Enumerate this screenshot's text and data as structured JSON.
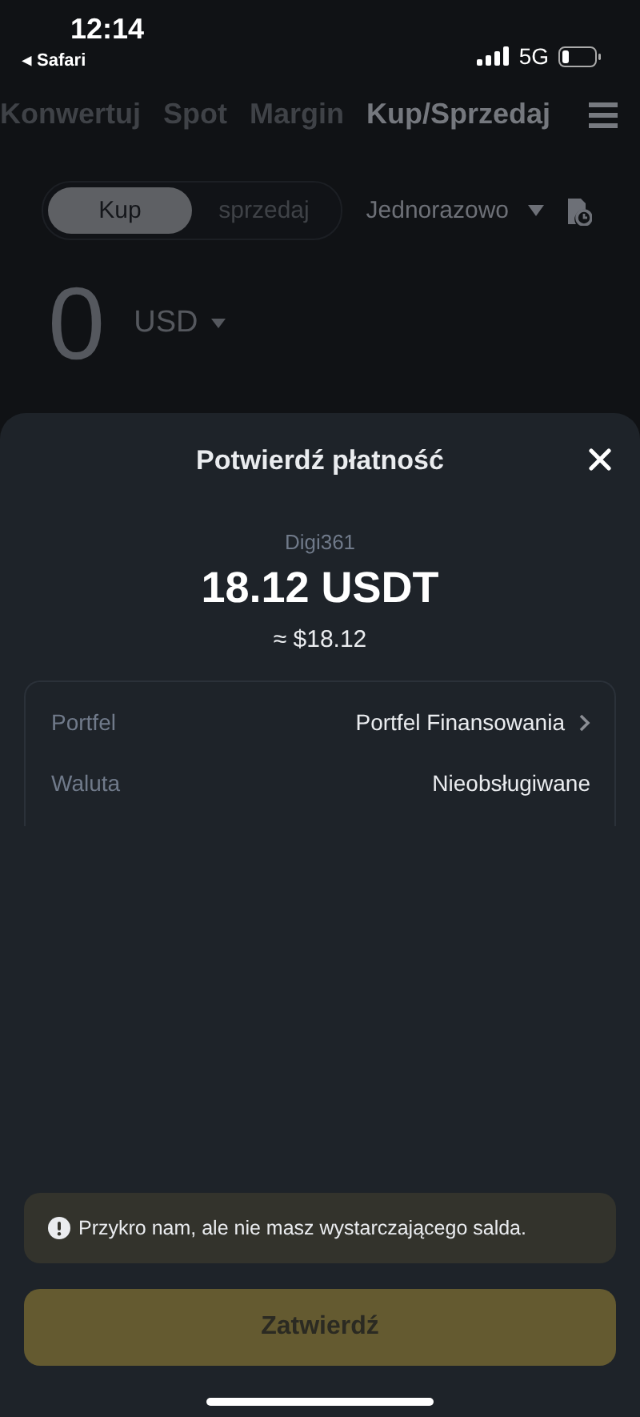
{
  "status_bar": {
    "time": "12:14",
    "back_app": "◂ Safari",
    "network": "5G"
  },
  "tabs": [
    {
      "label": "Konwertuj",
      "selected": false
    },
    {
      "label": "Spot",
      "selected": false
    },
    {
      "label": "Margin",
      "selected": false
    },
    {
      "label": "Kup/Sprzedaj",
      "selected": true
    }
  ],
  "trade_toggle": [
    {
      "label": "Kup",
      "selected": true
    },
    {
      "label": "sprzedaj",
      "selected": false
    }
  ],
  "frequency": {
    "label": "Jednorazowo"
  },
  "amount": {
    "value": "0",
    "currency": "USD"
  },
  "sheet": {
    "title": "Potwierdź płatność",
    "merchant": "Digi361",
    "amount": "18.12 USDT",
    "approx": "≈ $18.12",
    "details": [
      {
        "label": "Portfel",
        "value": "Portfel Finansowania",
        "link": true
      },
      {
        "label": "Waluta",
        "value": "Nieobsługiwane",
        "link": false
      }
    ],
    "alert": "Przykro nam, ale nie masz wystarczającego salda.",
    "confirm": {
      "label": "Zatwierdź",
      "disabled": true
    }
  }
}
